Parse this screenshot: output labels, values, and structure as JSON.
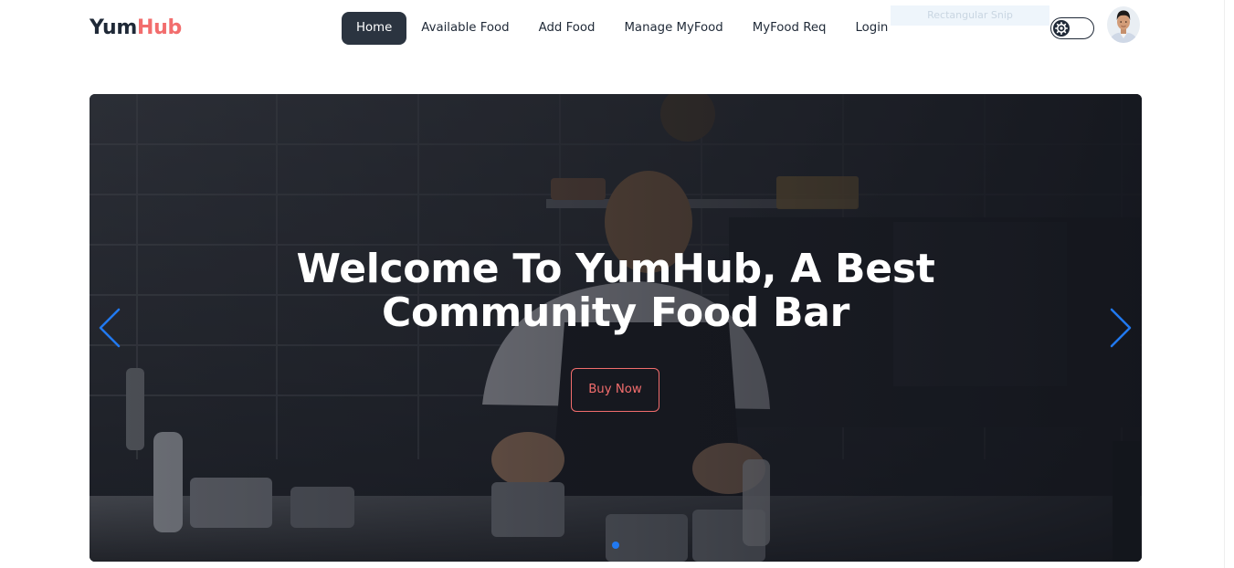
{
  "brand": {
    "part1": "Yum",
    "part2": "Hub",
    "accent_color": "#f26d6d"
  },
  "nav": {
    "items": [
      {
        "label": "Home",
        "active": true
      },
      {
        "label": "Available Food",
        "active": false
      },
      {
        "label": "Add Food",
        "active": false
      },
      {
        "label": "Manage MyFood",
        "active": false
      },
      {
        "label": "MyFood Req",
        "active": false
      },
      {
        "label": "Login",
        "active": false
      }
    ],
    "active_bg": "#2b3440"
  },
  "overlay_label": "Rectangular Snip",
  "theme_toggle": {
    "icon": "gear-icon",
    "state": "off"
  },
  "user": {
    "avatar_icon": "user-avatar"
  },
  "hero": {
    "title_line1": "Welcome To YumHub, A Best",
    "title_line2": "Community Food Bar",
    "button_label": "Buy Now",
    "prev_icon": "chevron-left-icon",
    "next_icon": "chevron-right-icon",
    "arrow_color": "#2179f0",
    "active_slide_index": 0,
    "slide_count": 1
  }
}
